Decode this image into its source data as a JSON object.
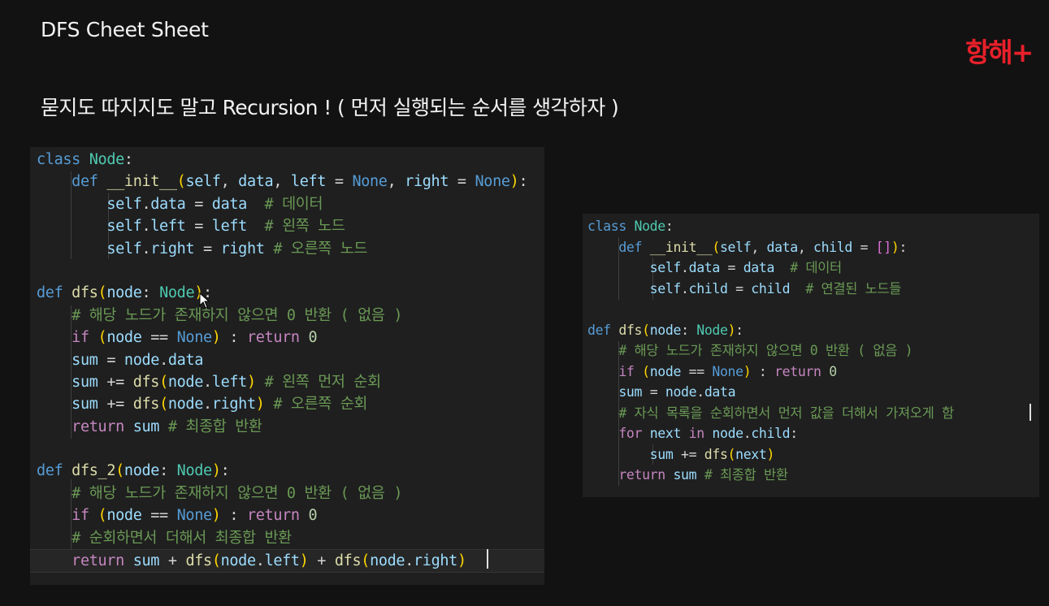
{
  "title": "DFS Cheet Sheet",
  "subtitle": "묻지도 따지지도 말고 Recursion ! ( 먼저 실행되는 순서를 생각하자 )",
  "brand": "항해+",
  "colors": {
    "background": "#121212",
    "panel": "#1f1f1f",
    "keyword": "#569cd6",
    "control": "#c586c0",
    "class_name": "#4ec9b0",
    "function": "#dcdcaa",
    "comment": "#6a9955",
    "number": "#b5cea8",
    "variable": "#9cdcfe",
    "brand": "#e8202a"
  },
  "panels": [
    {
      "lines": [
        [
          [
            "kw",
            "class"
          ],
          [
            "op",
            " "
          ],
          [
            "cls",
            "Node"
          ],
          [
            "op",
            ":"
          ]
        ],
        [
          [
            "op",
            "    "
          ],
          [
            "kw",
            "def"
          ],
          [
            "op",
            " "
          ],
          [
            "fn",
            "__init__"
          ],
          [
            "p1",
            "("
          ],
          [
            "v",
            "self"
          ],
          [
            "op",
            ", "
          ],
          [
            "v",
            "data"
          ],
          [
            "op",
            ", "
          ],
          [
            "v",
            "left"
          ],
          [
            "op",
            " = "
          ],
          [
            "kw",
            "None"
          ],
          [
            "op",
            ", "
          ],
          [
            "v",
            "right"
          ],
          [
            "op",
            " = "
          ],
          [
            "kw",
            "None"
          ],
          [
            "p1",
            ")"
          ],
          [
            "op",
            ":"
          ]
        ],
        [
          [
            "op",
            "        "
          ],
          [
            "v",
            "self"
          ],
          [
            "op",
            "."
          ],
          [
            "v",
            "data"
          ],
          [
            "op",
            " = "
          ],
          [
            "v",
            "data"
          ],
          [
            "op",
            "  "
          ],
          [
            "cmt",
            "# 데이터"
          ]
        ],
        [
          [
            "op",
            "        "
          ],
          [
            "v",
            "self"
          ],
          [
            "op",
            "."
          ],
          [
            "v",
            "left"
          ],
          [
            "op",
            " = "
          ],
          [
            "v",
            "left"
          ],
          [
            "op",
            "  "
          ],
          [
            "cmt",
            "# 왼쪽 노드"
          ]
        ],
        [
          [
            "op",
            "        "
          ],
          [
            "v",
            "self"
          ],
          [
            "op",
            "."
          ],
          [
            "v",
            "right"
          ],
          [
            "op",
            " = "
          ],
          [
            "v",
            "right"
          ],
          [
            "op",
            " "
          ],
          [
            "cmt",
            "# 오른쪽 노드"
          ]
        ],
        [],
        [
          [
            "kw",
            "def"
          ],
          [
            "op",
            " "
          ],
          [
            "fn",
            "dfs"
          ],
          [
            "p1",
            "("
          ],
          [
            "v",
            "node"
          ],
          [
            "op",
            ": "
          ],
          [
            "cls",
            "Node"
          ],
          [
            "p1",
            ")"
          ],
          [
            "op",
            ":"
          ]
        ],
        [
          [
            "op",
            "    "
          ],
          [
            "cmt",
            "# 해당 노드가 존재하지 않으면 0 반환 ( 없음 )"
          ]
        ],
        [
          [
            "op",
            "    "
          ],
          [
            "ctl",
            "if"
          ],
          [
            "op",
            " "
          ],
          [
            "p1",
            "("
          ],
          [
            "v",
            "node"
          ],
          [
            "op",
            " == "
          ],
          [
            "kw",
            "None"
          ],
          [
            "p1",
            ")"
          ],
          [
            "op",
            " : "
          ],
          [
            "ctl",
            "return"
          ],
          [
            "op",
            " "
          ],
          [
            "num",
            "0"
          ]
        ],
        [
          [
            "op",
            "    "
          ],
          [
            "v",
            "sum"
          ],
          [
            "op",
            " = "
          ],
          [
            "v",
            "node"
          ],
          [
            "op",
            "."
          ],
          [
            "v",
            "data"
          ]
        ],
        [
          [
            "op",
            "    "
          ],
          [
            "v",
            "sum"
          ],
          [
            "op",
            " += "
          ],
          [
            "fn",
            "dfs"
          ],
          [
            "p1",
            "("
          ],
          [
            "v",
            "node"
          ],
          [
            "op",
            "."
          ],
          [
            "v",
            "left"
          ],
          [
            "p1",
            ")"
          ],
          [
            "op",
            " "
          ],
          [
            "cmt",
            "# 왼쪽 먼저 순회"
          ]
        ],
        [
          [
            "op",
            "    "
          ],
          [
            "v",
            "sum"
          ],
          [
            "op",
            " += "
          ],
          [
            "fn",
            "dfs"
          ],
          [
            "p1",
            "("
          ],
          [
            "v",
            "node"
          ],
          [
            "op",
            "."
          ],
          [
            "v",
            "right"
          ],
          [
            "p1",
            ")"
          ],
          [
            "op",
            " "
          ],
          [
            "cmt",
            "# 오른쪽 순회"
          ]
        ],
        [
          [
            "op",
            "    "
          ],
          [
            "ctl",
            "return"
          ],
          [
            "op",
            " "
          ],
          [
            "v",
            "sum"
          ],
          [
            "op",
            " "
          ],
          [
            "cmt",
            "# 최종합 반환"
          ]
        ],
        [],
        [
          [
            "kw",
            "def"
          ],
          [
            "op",
            " "
          ],
          [
            "fn",
            "dfs_2"
          ],
          [
            "p1",
            "("
          ],
          [
            "v",
            "node"
          ],
          [
            "op",
            ": "
          ],
          [
            "cls",
            "Node"
          ],
          [
            "p1",
            ")"
          ],
          [
            "op",
            ":"
          ]
        ],
        [
          [
            "op",
            "    "
          ],
          [
            "cmt",
            "# 해당 노드가 존재하지 않으면 0 반환 ( 없음 )"
          ]
        ],
        [
          [
            "op",
            "    "
          ],
          [
            "ctl",
            "if"
          ],
          [
            "op",
            " "
          ],
          [
            "p1",
            "("
          ],
          [
            "v",
            "node"
          ],
          [
            "op",
            " == "
          ],
          [
            "kw",
            "None"
          ],
          [
            "p1",
            ")"
          ],
          [
            "op",
            " : "
          ],
          [
            "ctl",
            "return"
          ],
          [
            "op",
            " "
          ],
          [
            "num",
            "0"
          ]
        ],
        [
          [
            "op",
            "    "
          ],
          [
            "cmt",
            "# 순회하면서 더해서 최종합 반환"
          ]
        ],
        [
          [
            "op",
            "    "
          ],
          [
            "ctl",
            "return"
          ],
          [
            "op",
            " "
          ],
          [
            "v",
            "sum"
          ],
          [
            "op",
            " + "
          ],
          [
            "fn",
            "dfs"
          ],
          [
            "p1",
            "("
          ],
          [
            "v",
            "node"
          ],
          [
            "op",
            "."
          ],
          [
            "v",
            "left"
          ],
          [
            "p1",
            ")"
          ],
          [
            "op",
            " + "
          ],
          [
            "fn",
            "dfs"
          ],
          [
            "p1",
            "("
          ],
          [
            "v",
            "node"
          ],
          [
            "op",
            "."
          ],
          [
            "v",
            "right"
          ],
          [
            "p1",
            ")"
          ]
        ]
      ]
    },
    {
      "lines": [
        [
          [
            "kw",
            "class"
          ],
          [
            "op",
            " "
          ],
          [
            "cls",
            "Node"
          ],
          [
            "op",
            ":"
          ]
        ],
        [
          [
            "op",
            "    "
          ],
          [
            "kw",
            "def"
          ],
          [
            "op",
            " "
          ],
          [
            "fn",
            "__init__"
          ],
          [
            "p1",
            "("
          ],
          [
            "v",
            "self"
          ],
          [
            "op",
            ", "
          ],
          [
            "v",
            "data"
          ],
          [
            "op",
            ", "
          ],
          [
            "v",
            "child"
          ],
          [
            "op",
            " = "
          ],
          [
            "p2",
            "[]"
          ],
          [
            "p1",
            ")"
          ],
          [
            "op",
            ":"
          ]
        ],
        [
          [
            "op",
            "        "
          ],
          [
            "v",
            "self"
          ],
          [
            "op",
            "."
          ],
          [
            "v",
            "data"
          ],
          [
            "op",
            " = "
          ],
          [
            "v",
            "data"
          ],
          [
            "op",
            "  "
          ],
          [
            "cmt",
            "# 데이터"
          ]
        ],
        [
          [
            "op",
            "        "
          ],
          [
            "v",
            "self"
          ],
          [
            "op",
            "."
          ],
          [
            "v",
            "child"
          ],
          [
            "op",
            " = "
          ],
          [
            "v",
            "child"
          ],
          [
            "op",
            "  "
          ],
          [
            "cmt",
            "# 연결된 노드들"
          ]
        ],
        [],
        [
          [
            "kw",
            "def"
          ],
          [
            "op",
            " "
          ],
          [
            "fn",
            "dfs"
          ],
          [
            "p1",
            "("
          ],
          [
            "v",
            "node"
          ],
          [
            "op",
            ": "
          ],
          [
            "cls",
            "Node"
          ],
          [
            "p1",
            ")"
          ],
          [
            "op",
            ":"
          ]
        ],
        [
          [
            "op",
            "    "
          ],
          [
            "cmt",
            "# 해당 노드가 존재하지 않으면 0 반환 ( 없음 )"
          ]
        ],
        [
          [
            "op",
            "    "
          ],
          [
            "ctl",
            "if"
          ],
          [
            "op",
            " "
          ],
          [
            "p1",
            "("
          ],
          [
            "v",
            "node"
          ],
          [
            "op",
            " == "
          ],
          [
            "kw",
            "None"
          ],
          [
            "p1",
            ")"
          ],
          [
            "op",
            " : "
          ],
          [
            "ctl",
            "return"
          ],
          [
            "op",
            " "
          ],
          [
            "num",
            "0"
          ]
        ],
        [
          [
            "op",
            "    "
          ],
          [
            "v",
            "sum"
          ],
          [
            "op",
            " = "
          ],
          [
            "v",
            "node"
          ],
          [
            "op",
            "."
          ],
          [
            "v",
            "data"
          ]
        ],
        [
          [
            "op",
            "    "
          ],
          [
            "cmt",
            "# 자식 목록을 순회하면서 먼저 값을 더해서 가져오게 함"
          ]
        ],
        [
          [
            "op",
            "    "
          ],
          [
            "ctl",
            "for"
          ],
          [
            "op",
            " "
          ],
          [
            "v",
            "next"
          ],
          [
            "op",
            " "
          ],
          [
            "ctl",
            "in"
          ],
          [
            "op",
            " "
          ],
          [
            "v",
            "node"
          ],
          [
            "op",
            "."
          ],
          [
            "v",
            "child"
          ],
          [
            "op",
            ":"
          ]
        ],
        [
          [
            "op",
            "        "
          ],
          [
            "v",
            "sum"
          ],
          [
            "op",
            " += "
          ],
          [
            "fn",
            "dfs"
          ],
          [
            "p1",
            "("
          ],
          [
            "v",
            "next"
          ],
          [
            "p1",
            ")"
          ]
        ],
        [
          [
            "op",
            "    "
          ],
          [
            "ctl",
            "return"
          ],
          [
            "op",
            " "
          ],
          [
            "v",
            "sum"
          ],
          [
            "op",
            " "
          ],
          [
            "cmt",
            "# 최종합 반환"
          ]
        ]
      ]
    }
  ]
}
